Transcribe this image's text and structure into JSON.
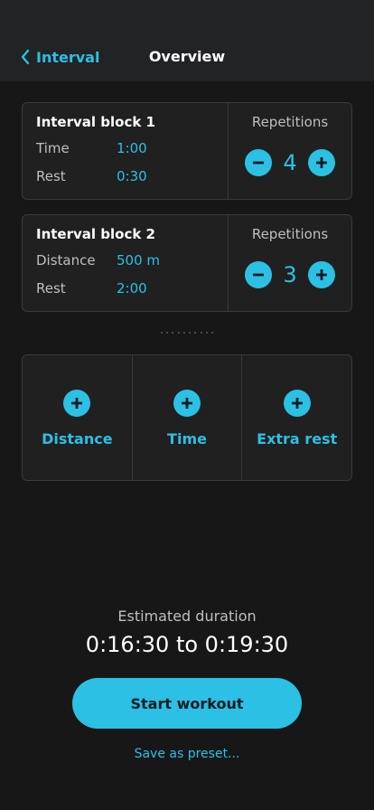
{
  "header": {
    "back_label": "Interval",
    "title": "Overview"
  },
  "blocks": [
    {
      "title": "Interval block 1",
      "rows": [
        {
          "key": "Time",
          "value": "1:00"
        },
        {
          "key": "Rest",
          "value": "0:30"
        }
      ],
      "repetitions_label": "Repetitions",
      "repetitions": "4"
    },
    {
      "title": "Interval block 2",
      "rows": [
        {
          "key": "Distance",
          "value": "500 m"
        },
        {
          "key": "Rest",
          "value": "2:00"
        }
      ],
      "repetitions_label": "Repetitions",
      "repetitions": "3"
    }
  ],
  "add_options": [
    {
      "label": "Distance"
    },
    {
      "label": "Time"
    },
    {
      "label": "Extra rest"
    }
  ],
  "footer": {
    "estimated_label": "Estimated duration",
    "estimated_value": "0:16:30 to 0:19:30",
    "start_label": "Start workout",
    "preset_label": "Save as preset..."
  },
  "colors": {
    "accent": "#2bc0e4",
    "background": "#171717",
    "card": "#202021",
    "header": "#222325"
  }
}
